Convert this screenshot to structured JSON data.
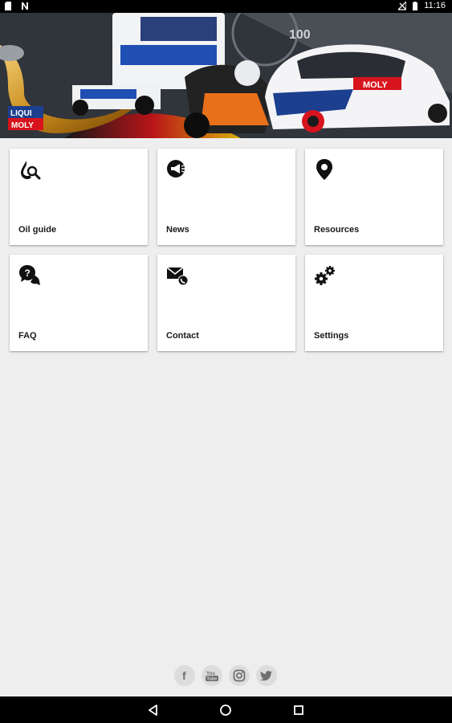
{
  "status_bar": {
    "time": "11:16",
    "icons": [
      "sim-icon",
      "notification-n-icon",
      "signal-off-icon",
      "battery-icon"
    ]
  },
  "banner": {
    "brand_line1": "LIQUI",
    "brand_line2": "MOLY",
    "speed": "100",
    "car_livery": "MOLY"
  },
  "tiles": [
    {
      "label": "Oil guide",
      "icon": "oil-drop-search-icon"
    },
    {
      "label": "News",
      "icon": "megaphone-icon"
    },
    {
      "label": "Resources",
      "icon": "map-pin-icon"
    },
    {
      "label": "FAQ",
      "icon": "question-chat-icon"
    },
    {
      "label": "Contact",
      "icon": "mail-phone-icon"
    },
    {
      "label": "Settings",
      "icon": "gears-icon"
    }
  ],
  "social": [
    "facebook-icon",
    "youtube-icon",
    "instagram-icon",
    "twitter-icon"
  ],
  "social_text": {
    "facebook": "f",
    "youtube": "You\nTube"
  },
  "navbar": [
    "back-icon",
    "home-icon",
    "recents-icon"
  ],
  "colors": {
    "brand_red": "#d7141d",
    "brand_blue": "#1d3f8f",
    "tile_bg": "#ffffff",
    "page_bg": "#eeeeee"
  }
}
